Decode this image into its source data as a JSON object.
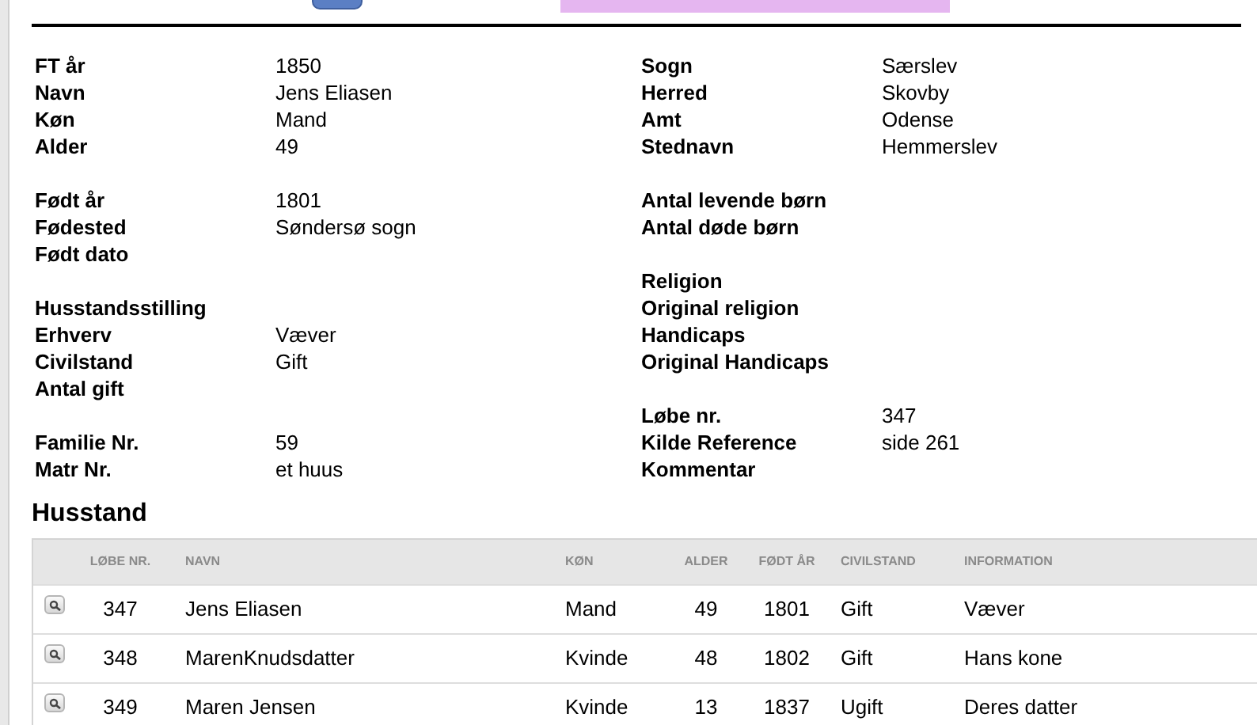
{
  "fields": {
    "left": [
      [
        {
          "label": "FT år",
          "value": "1850"
        },
        {
          "label": "Navn",
          "value": "Jens Eliasen"
        },
        {
          "label": "Køn",
          "value": "Mand"
        },
        {
          "label": "Alder",
          "value": "49"
        }
      ],
      [
        {
          "label": "Født år",
          "value": "1801"
        },
        {
          "label": "Fødested",
          "value": "Søndersø sogn"
        },
        {
          "label": "Født dato"
        }
      ],
      [
        {
          "label": "Husstandsstilling"
        },
        {
          "label": "Erhverv",
          "value": "Væver"
        },
        {
          "label": "Civilstand",
          "value": "Gift"
        },
        {
          "label": "Antal gift"
        }
      ],
      [
        {
          "label": "Familie Nr.",
          "value": "59"
        },
        {
          "label": "Matr Nr.",
          "value": "et huus"
        }
      ]
    ],
    "right": [
      [
        {
          "label": "Sogn",
          "value": "Særslev"
        },
        {
          "label": "Herred",
          "value": "Skovby"
        },
        {
          "label": "Amt",
          "value": "Odense"
        },
        {
          "label": "Stednavn",
          "value": "Hemmerslev"
        }
      ],
      [
        {
          "label": "Antal levende børn"
        },
        {
          "label": "Antal døde børn"
        }
      ],
      [
        {
          "label": "Religion"
        },
        {
          "label": "Original religion"
        },
        {
          "label": "Handicaps"
        },
        {
          "label": "Original Handicaps"
        }
      ],
      [
        {
          "label": "Løbe nr.",
          "value": "347"
        },
        {
          "label": "Kilde Reference",
          "value": "side 261"
        },
        {
          "label": "Kommentar"
        }
      ]
    ]
  },
  "household": {
    "title": "Husstand",
    "columns": [
      "LØBE NR.",
      "NAVN",
      "KØN",
      "ALDER",
      "FØDT ÅR",
      "CIVILSTAND",
      "INFORMATION"
    ],
    "rows": [
      [
        "347",
        "Jens Eliasen",
        "Mand",
        "49",
        "1801",
        "Gift",
        "Væver"
      ],
      [
        "348",
        "MarenKnudsdatter",
        "Kvinde",
        "48",
        "1802",
        "Gift",
        "Hans kone"
      ],
      [
        "349",
        "Maren Jensen",
        "Kvinde",
        "13",
        "1837",
        "Ugift",
        "Deres datter"
      ]
    ]
  }
}
